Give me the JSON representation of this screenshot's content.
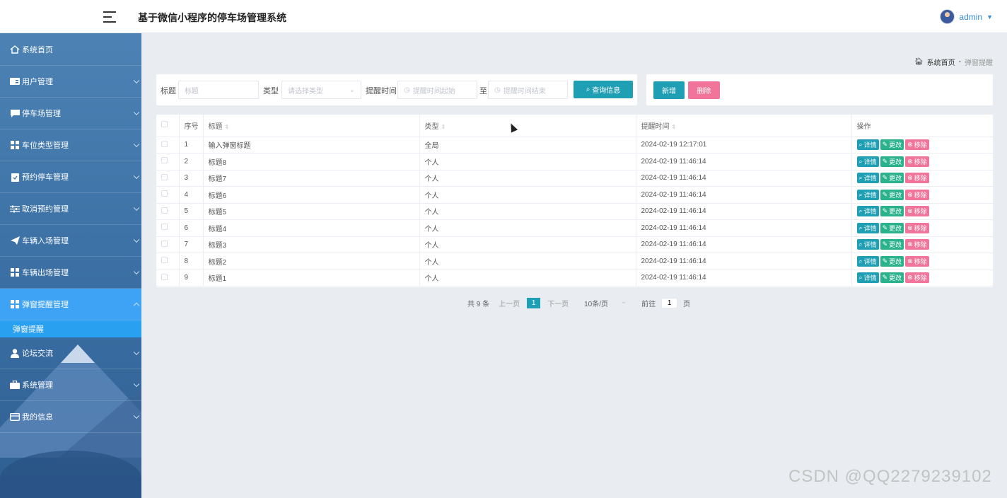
{
  "header": {
    "title": "基于微信小程序的停车场管理系统",
    "username": "admin"
  },
  "sidebar": {
    "items": [
      {
        "label": "系统首页",
        "icon": "home-icon"
      },
      {
        "label": "用户管理",
        "icon": "user-card-icon"
      },
      {
        "label": "停车场管理",
        "icon": "chat-icon"
      },
      {
        "label": "车位类型管理",
        "icon": "grid-icon"
      },
      {
        "label": "预约停车管理",
        "icon": "clipboard-icon"
      },
      {
        "label": "取消预约管理",
        "icon": "sliders-icon"
      },
      {
        "label": "车辆入场管理",
        "icon": "send-icon"
      },
      {
        "label": "车辆出场管理",
        "icon": "grid-icon"
      },
      {
        "label": "弹窗提醒管理",
        "icon": "grid-icon"
      },
      {
        "label": "论坛交流",
        "icon": "person-icon"
      },
      {
        "label": "系统管理",
        "icon": "briefcase-icon"
      },
      {
        "label": "我的信息",
        "icon": "card-icon"
      }
    ],
    "sub_item": "弹窗提醒",
    "active_color": "#3ea2f5"
  },
  "breadcrumb": {
    "home": "系统首页",
    "separator": "-",
    "current": "弹窗提醒"
  },
  "search": {
    "title_label": "标题",
    "title_placeholder": "标题",
    "type_label": "类型",
    "type_placeholder": "请选择类型",
    "time_label": "提醒时间",
    "time_start_placeholder": "提醒时间起始",
    "to_label": "至",
    "time_end_placeholder": "提醒时间结束",
    "search_button": "查询信息"
  },
  "actions": {
    "add": "新增",
    "delete": "删除"
  },
  "table": {
    "headers": {
      "index": "序号",
      "title": "标题",
      "type": "类型",
      "time": "提醒时间",
      "ops": "操作"
    },
    "op_labels": {
      "detail": "详情",
      "edit": "更改",
      "remove": "移除"
    },
    "rows": [
      {
        "index": "1",
        "title": "输入弹窗标题",
        "type": "全局",
        "time": "2024-02-19 12:17:01"
      },
      {
        "index": "2",
        "title": "标题8",
        "type": "个人",
        "time": "2024-02-19 11:46:14"
      },
      {
        "index": "3",
        "title": "标题7",
        "type": "个人",
        "time": "2024-02-19 11:46:14"
      },
      {
        "index": "4",
        "title": "标题6",
        "type": "个人",
        "time": "2024-02-19 11:46:14"
      },
      {
        "index": "5",
        "title": "标题5",
        "type": "个人",
        "time": "2024-02-19 11:46:14"
      },
      {
        "index": "6",
        "title": "标题4",
        "type": "个人",
        "time": "2024-02-19 11:46:14"
      },
      {
        "index": "7",
        "title": "标题3",
        "type": "个人",
        "time": "2024-02-19 11:46:14"
      },
      {
        "index": "8",
        "title": "标题2",
        "type": "个人",
        "time": "2024-02-19 11:46:14"
      },
      {
        "index": "9",
        "title": "标题1",
        "type": "个人",
        "time": "2024-02-19 11:46:14"
      }
    ]
  },
  "pagination": {
    "total": "共 9 条",
    "prev": "上一页",
    "current": "1",
    "next": "下一页",
    "page_size": "10条/页",
    "goto": "前往",
    "goto_value": "1",
    "page_unit": "页"
  },
  "watermark": "CSDN @QQ2279239102",
  "colors": {
    "primary": "#1f9fb4",
    "edit": "#2ab28c",
    "danger": "#f1749a",
    "sidebar": "#4c82b4"
  }
}
